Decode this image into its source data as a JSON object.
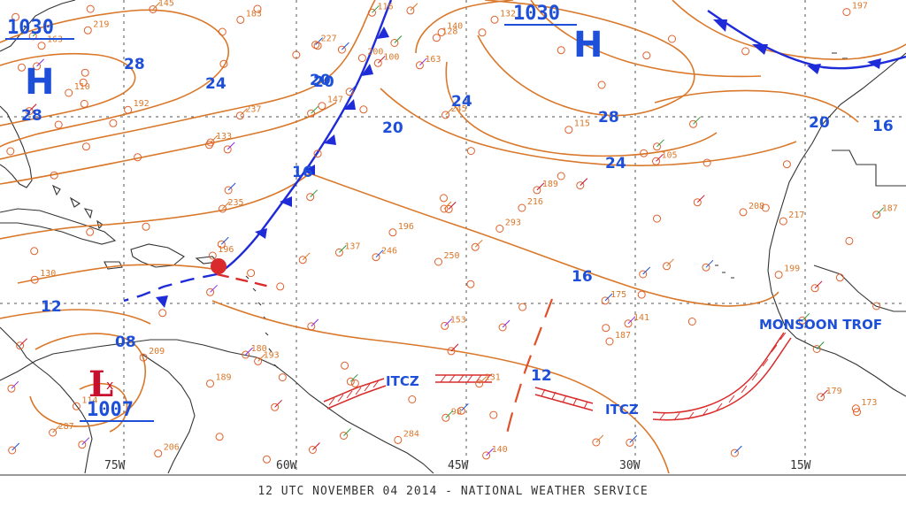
{
  "title": "12 UTC NOVEMBER 04 2014 - NATIONAL WEATHER SERVICE",
  "colors": {
    "isobar": "#d9782a",
    "front": "#1e2bd8",
    "label": "#1e4fd8",
    "low": "#c8102e",
    "itcz": "#d92b2b",
    "land": "#333333",
    "grid": "#444444"
  },
  "longitudes": [
    "75W",
    "60W",
    "45W",
    "30W",
    "15W"
  ],
  "pressure_centers": [
    {
      "type": "H",
      "value": "1030",
      "where": "west"
    },
    {
      "type": "H",
      "value": "1030",
      "where": "central"
    },
    {
      "type": "L",
      "value": "1007",
      "where": "southwest"
    }
  ],
  "isobar_labels": [
    "28",
    "28",
    "24",
    "20",
    "20",
    "24",
    "28",
    "24",
    "20",
    "16",
    "20",
    "16",
    "12",
    "08",
    "16",
    "12"
  ],
  "features": {
    "itcz_1": "ITCZ",
    "itcz_2": "ITCZ",
    "monsoon": "MONSOON TROF"
  },
  "station_values": [
    "250",
    "235",
    "199",
    "193",
    "245",
    "293",
    "287",
    "284",
    "246",
    "206",
    "196",
    "209",
    "227",
    "217",
    "189",
    "192",
    "219",
    "175",
    "196",
    "208",
    "237",
    "180",
    "179",
    "132",
    "147",
    "187",
    "197",
    "216",
    "187",
    "163",
    "183",
    "141",
    "189",
    "163",
    "131",
    "140",
    "128",
    "133",
    "145",
    "200",
    "116",
    "105",
    "115",
    "114",
    "110",
    "130",
    "137",
    "100",
    "98",
    "173",
    "153",
    "140"
  ]
}
